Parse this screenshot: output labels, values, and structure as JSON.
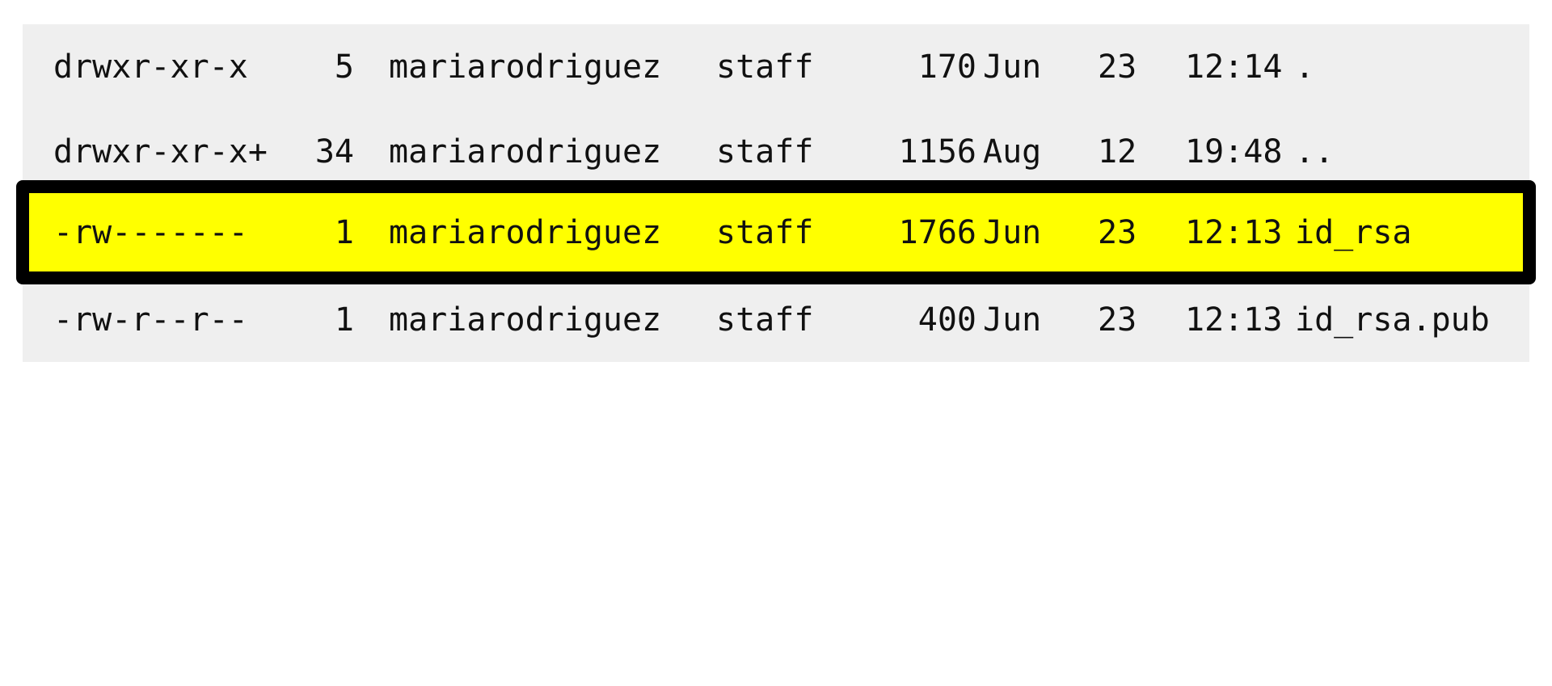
{
  "listing": {
    "rows": [
      {
        "perm": "drwxr-xr-x",
        "links": "5",
        "owner": "mariarodriguez",
        "group": "staff",
        "size": "170",
        "month": "Jun",
        "day": "23",
        "time": "12:14",
        "name": "."
      },
      {
        "perm": "drwxr-xr-x+",
        "links": "34",
        "owner": "mariarodriguez",
        "group": "staff",
        "size": "1156",
        "month": "Aug",
        "day": "12",
        "time": "19:48",
        "name": ".."
      },
      {
        "perm": "-rw-------",
        "links": "1",
        "owner": "mariarodriguez",
        "group": "staff",
        "size": "1766",
        "month": "Jun",
        "day": "23",
        "time": "12:13",
        "name": "id_rsa"
      },
      {
        "perm": "-rw-r--r--",
        "links": "1",
        "owner": "mariarodriguez",
        "group": "staff",
        "size": "400",
        "month": "Jun",
        "day": "23",
        "time": "12:13",
        "name": "id_rsa.pub"
      }
    ],
    "highlighted_row": 2
  },
  "colors": {
    "background": "#efefef",
    "highlight_fill": "#ffff00",
    "highlight_border": "#000000",
    "text": "#111111"
  }
}
